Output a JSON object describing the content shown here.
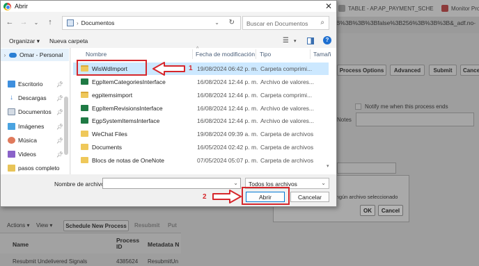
{
  "background": {
    "tabs": [
      {
        "label": "TABLE - AP.AP_PAYMENT_SCHE"
      },
      {
        "label": "Monitor Pro"
      }
    ],
    "url_fragment": "3B%3B%3B%3Bfalse%3B256%3B%3B%3B&_adf.no-",
    "buttons": {
      "process_options": "Process Options",
      "advanced": "Advanced",
      "submit": "Submit",
      "cancel": "Cance"
    },
    "notify_label": "Notify me when this process ends",
    "notes_label": "Notes",
    "modal": {
      "message": "ingún archivo seleccionado",
      "ok": "OK",
      "cancel": "Cancel"
    },
    "actions_bar": {
      "actions": "Actions",
      "view": "View",
      "schedule": "Schedule New Process",
      "resubmit": "Resubmit",
      "put": "Put"
    },
    "table": {
      "headers": [
        "Name",
        "Process ID",
        "Metadata N"
      ],
      "rows": [
        {
          "name": "Resubmit Undelivered Signals",
          "id": "4385624",
          "meta": "ResubmitUn"
        }
      ]
    }
  },
  "dialog": {
    "title": "Abrir",
    "address": {
      "location": "Documentos"
    },
    "search": {
      "placeholder": "Buscar en Documentos"
    },
    "toolbar": {
      "organize": "Organizar",
      "new_folder": "Nueva carpeta"
    },
    "nav": [
      {
        "label": "Omar - Personal",
        "icon": "cloud-icon"
      },
      {
        "label": "Escritorio",
        "icon": "desktop-icon"
      },
      {
        "label": "Descargas",
        "icon": "download-icon"
      },
      {
        "label": "Documentos",
        "icon": "documents-icon"
      },
      {
        "label": "Imágenes",
        "icon": "pictures-icon"
      },
      {
        "label": "Música",
        "icon": "music-icon"
      },
      {
        "label": "Videos",
        "icon": "videos-icon"
      },
      {
        "label": "pasos completo",
        "icon": "folder-icon"
      }
    ],
    "columns": {
      "name": "Nombre",
      "date": "Fecha de modificación",
      "type": "Tipo",
      "size": "Tamañ"
    },
    "files": [
      {
        "name": "WisWdImport",
        "date": "19/08/2024 06:42 p. m.",
        "type": "Carpeta comprimi...",
        "icon": "zip-folder-icon"
      },
      {
        "name": "EgpItemCategoriesInterface",
        "date": "16/08/2024 12:44 p. m.",
        "type": "Archivo de valores...",
        "icon": "excel-csv-icon"
      },
      {
        "name": "egpitemsimport",
        "date": "16/08/2024 12:44 p. m.",
        "type": "Carpeta comprimi...",
        "icon": "zip-folder-icon"
      },
      {
        "name": "EgpItemRevisionsInterface",
        "date": "16/08/2024 12:44 p. m.",
        "type": "Archivo de valores...",
        "icon": "excel-csv-icon"
      },
      {
        "name": "EgpSystemItemsInterface",
        "date": "16/08/2024 12:44 p. m.",
        "type": "Archivo de valores...",
        "icon": "excel-csv-icon"
      },
      {
        "name": "WeChat Files",
        "date": "19/08/2024 09:39 a. m.",
        "type": "Carpeta de archivos",
        "icon": "folder-icon"
      },
      {
        "name": "Documents",
        "date": "16/05/2024 02:42 p. m.",
        "type": "Carpeta de archivos",
        "icon": "folder-icon"
      },
      {
        "name": "Blocs de notas de OneNote",
        "date": "07/05/2024 05:07 p. m.",
        "type": "Carpeta de archivos",
        "icon": "folder-icon"
      }
    ],
    "filename_label": "Nombre de archivo:",
    "filename_value": "",
    "filetype": "Todos los archivos",
    "open_button": "Abrir",
    "cancel_button": "Cancelar"
  },
  "annotations": {
    "step1": "1",
    "step2": "2",
    "color": "#d6262b"
  }
}
